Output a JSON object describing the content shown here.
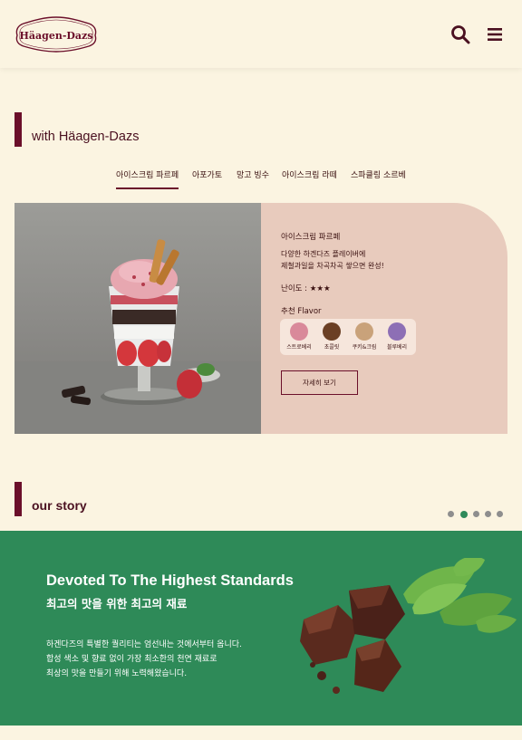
{
  "brand": {
    "logo_text": "Häagen-Dazs"
  },
  "header": {
    "search_icon": "search-icon",
    "menu_icon": "hamburger-menu-icon"
  },
  "section_with": {
    "title": "with Häagen-Dazs"
  },
  "tabs": [
    {
      "label": "아이스크림 파르페",
      "active": true
    },
    {
      "label": "아포가토",
      "active": false
    },
    {
      "label": "망고 빙수",
      "active": false
    },
    {
      "label": "아이스크림 라떼",
      "active": false
    },
    {
      "label": "스파클링 소르베",
      "active": false
    }
  ],
  "recipe": {
    "title": "아이스크림 파르페",
    "desc_line1": "다양한 하겐다즈 플레이버에",
    "desc_line2": "제철과일을 차곡차곡 쌓으면 완성!",
    "level": "난이도 : ★★★",
    "flavor_label": "추천 Flavor",
    "flavors": [
      {
        "name": "스트로베리",
        "color": "#d9899a"
      },
      {
        "name": "초콜릿",
        "color": "#6b3f24"
      },
      {
        "name": "쿠키&크림",
        "color": "#c9a27a"
      },
      {
        "name": "블루베리",
        "color": "#8d6fb5"
      }
    ],
    "detail_button": "자세히 보기"
  },
  "section_story": {
    "title": "our story"
  },
  "carousel": {
    "count": 5,
    "active_index": 1
  },
  "story": {
    "headline_en": "Devoted To The Highest Standards",
    "headline_ko": "최고의 맛을 위한 최고의 재료",
    "body_line1": "하겐다즈의 특별한 퀄리티는 엄선내는 것에서부터 옵니다.",
    "body_line2": "합성 색소 및 향료 없이 가장 최소한의 천연 재료로",
    "body_line3": "최상의 맛을 만들기 위해 노력해왔습니다."
  },
  "colors": {
    "background": "#fbf4e1",
    "brand": "#6b0f2a",
    "story_green": "#2e8a58",
    "card_pink": "#e8cbbd"
  }
}
